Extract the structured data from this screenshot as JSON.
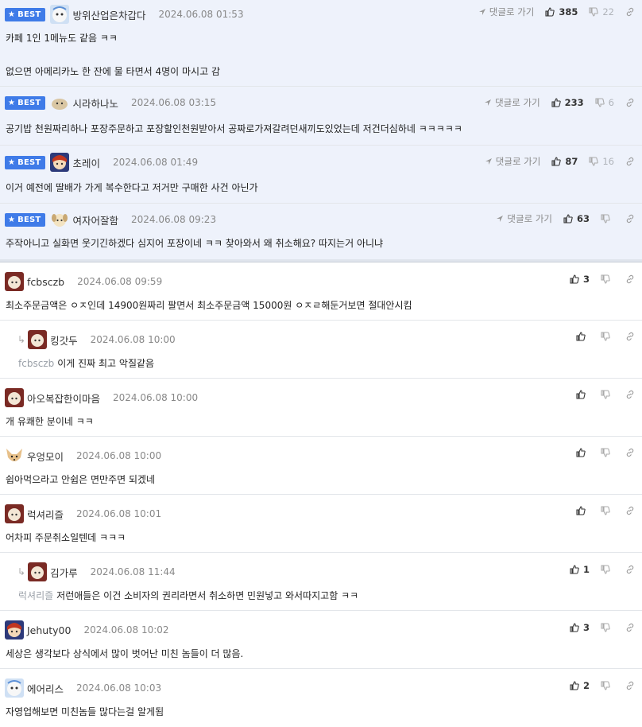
{
  "best_label": "BEST",
  "goto_label": "댓글로 가기",
  "best_comments": [
    {
      "nick": "방위산업은차갑다",
      "date": "2024.06.08 01:53",
      "line1": "카페 1인 1메뉴도 같음 ㅋㅋ",
      "line2": "없으면 아메리카노 한 잔에 물 타면서 4명이 마시고 감",
      "likes": "385",
      "dislikes": "22"
    },
    {
      "nick": "시라하나노",
      "date": "2024.06.08 03:15",
      "line1": "공기밥 천원짜리하나 포장주문하고 포장할인천원받아서 공짜로가져갈려던새끼도있었는데 저건더심하네 ㅋㅋㅋㅋㅋ",
      "likes": "233",
      "dislikes": "6"
    },
    {
      "nick": "초레이",
      "date": "2024.06.08 01:49",
      "line1": "이거 예전에 딸배가 가게 복수한다고 저거만 구매한 사건 아닌가",
      "likes": "87",
      "dislikes": "16"
    },
    {
      "nick": "여자어잘함",
      "date": "2024.06.08 09:23",
      "line1": "주작아니고 실화면 웃기긴하겠다 심지어 포장이네 ㅋㅋ 찾아와서 왜 취소해요? 따지는거 아니냐",
      "likes": "63",
      "dislikes": ""
    }
  ],
  "comments": [
    {
      "nick": "fcbsczb",
      "date": "2024.06.08 09:59",
      "text": "최소주문금액은 ㅇㅈ인데 14900원짜리 팔면서 최소주문금액 15000원 ㅇㅈㄹ해둔거보면 절대안시킴",
      "likes": "3"
    },
    {
      "nick": "킹갓두",
      "date": "2024.06.08 10:00",
      "mention": "fcbsczb",
      "text": "이게 진짜 최고 악질같음",
      "likes": ""
    },
    {
      "nick": "아오복잡한이마음",
      "date": "2024.06.08 10:00",
      "text": "개 유쾌한 분이네 ㅋㅋ",
      "likes": ""
    },
    {
      "nick": "우엉모이",
      "date": "2024.06.08 10:00",
      "text": "쉽아먹으라고 안쉽은 면만주면 되겠네",
      "likes": ""
    },
    {
      "nick": "럭셔리즐",
      "date": "2024.06.08 10:01",
      "text": "어차피 주문취소일텐데 ㅋㅋㅋ",
      "likes": ""
    },
    {
      "nick": "김가루",
      "date": "2024.06.08 11:44",
      "mention": "럭셔리즐",
      "text": "저런애들은 이건 소비자의 권리라면서 취소하면 민원넣고 와서따지고함 ㅋㅋ",
      "likes": "1"
    },
    {
      "nick": "Jehuty00",
      "date": "2024.06.08 10:02",
      "text": "세상은 생각보다 상식에서 많이 벗어난 미친 놈들이 더 많음.",
      "likes": "3"
    },
    {
      "nick": "에어리스",
      "date": "2024.06.08 10:03",
      "text": "자영업해보면 미친놈들 많다는걸 알게됨",
      "likes": "2"
    }
  ],
  "colors": {
    "best_bg": "#eef2fb",
    "badge": "#3f7be8",
    "mention": "#9aa0a8"
  }
}
